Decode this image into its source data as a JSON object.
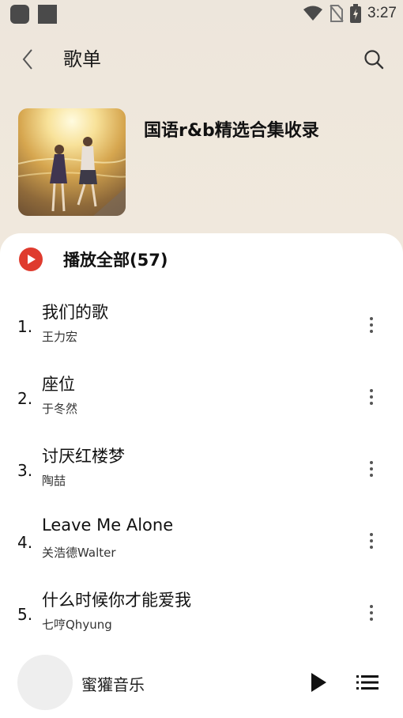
{
  "status_bar": {
    "time": "3:27",
    "icons": [
      "app-icon",
      "stop-icon",
      "wifi-icon",
      "no-sim-icon",
      "battery-charging-icon"
    ]
  },
  "header": {
    "title": "歌单",
    "back_icon": "chevron-left-icon",
    "search_icon": "search-icon"
  },
  "playlist": {
    "name": "国语r&b精选合集收录"
  },
  "play_all": {
    "label": "播放全部(57)",
    "icon": "play-circle-icon",
    "accent_color": "#df3b2e"
  },
  "songs": [
    {
      "index": "1.",
      "title": "我们的歌",
      "artist": "王力宏"
    },
    {
      "index": "2.",
      "title": "座位",
      "artist": "于冬然"
    },
    {
      "index": "3.",
      "title": "讨厌红楼梦",
      "artist": "陶喆"
    },
    {
      "index": "4.",
      "title": "Leave Me Alone",
      "artist": "关浩德Walter"
    },
    {
      "index": "5.",
      "title": "什么时候你才能爱我",
      "artist": "七哼Qhyung"
    }
  ],
  "mini_player": {
    "title": "蜜獾音乐",
    "play_icon": "play-icon",
    "queue_icon": "playlist-icon"
  }
}
